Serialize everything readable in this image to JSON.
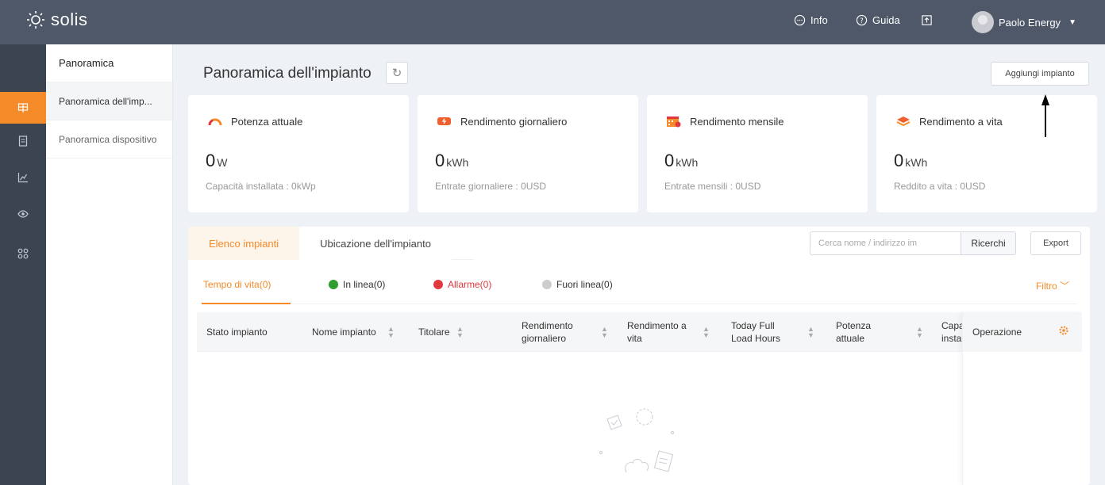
{
  "brand": {
    "name": "solis",
    "accent": "#f58a29"
  },
  "topbar": {
    "info_label": "Info",
    "guide_label": "Guida",
    "user_name": "Paolo Energy"
  },
  "sidebar": {
    "header": "Panoramica",
    "items": [
      {
        "label": "Panoramica dell'imp...",
        "active": true
      },
      {
        "label": "Panoramica dispositivo",
        "active": false
      }
    ],
    "rail_icons": [
      "plant-icon",
      "document-icon",
      "chart-icon",
      "eye-icon",
      "apps-icon"
    ]
  },
  "page": {
    "title": "Panoramica dell'impianto",
    "add_button": "Aggiungi impianto"
  },
  "cards": [
    {
      "title": "Potenza attuale",
      "value": "0",
      "unit": "W",
      "sub": "Capacità installata : 0kWp"
    },
    {
      "title": "Rendimento giornaliero",
      "value": "0",
      "unit": "kWh",
      "sub": "Entrate giornaliere : 0USD"
    },
    {
      "title": "Rendimento mensile",
      "value": "0",
      "unit": "kWh",
      "sub": "Entrate mensili : 0USD"
    },
    {
      "title": "Rendimento a vita",
      "value": "0",
      "unit": "kWh",
      "sub": "Reddito a vita : 0USD"
    }
  ],
  "list": {
    "tabs": [
      "Elenco impianti",
      "Ubicazione dell'impianto"
    ],
    "search_placeholder": "Cerca nome / indirizzo im",
    "search_button": "Ricerchi",
    "export_button": "Export",
    "filters": [
      {
        "label": "Tempo di vita(0)",
        "color": ""
      },
      {
        "label": "In linea(0)",
        "color": "#2e9e2e"
      },
      {
        "label": "Allarme(0)",
        "color": "#e0383e"
      },
      {
        "label": "Fuori linea(0)",
        "color": "#cccccc"
      }
    ],
    "filter_button": "Filtro",
    "columns": [
      "Stato impianto",
      "Nome impianto",
      "Titolare",
      "Rendimento giornaliero",
      "Rendimento a vita",
      "Today Full Load Hours",
      "Potenza attuale",
      "Capac installa"
    ],
    "operation_column": "Operazione"
  }
}
